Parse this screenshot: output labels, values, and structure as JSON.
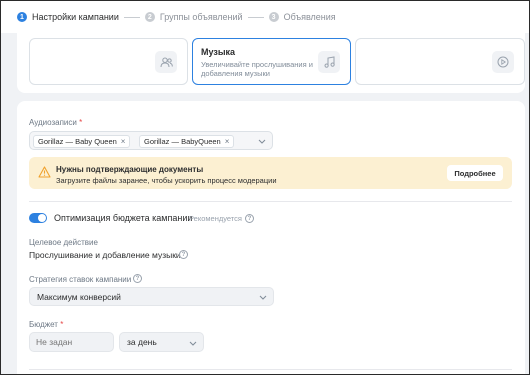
{
  "stepper": {
    "steps": [
      {
        "num": "1",
        "label": "Настройки кампании"
      },
      {
        "num": "2",
        "label": "Группы объявлений"
      },
      {
        "num": "3",
        "label": "Объявления"
      }
    ]
  },
  "objectives": {
    "cards": [
      {
        "title": "",
        "desc": "",
        "icon": "users-icon"
      },
      {
        "title": "Музыка",
        "desc": "Увеличивайте прослушивания и добавления музыки",
        "icon": "music-note-icon"
      },
      {
        "title": "",
        "desc": "",
        "icon": "play-circle-icon"
      }
    ]
  },
  "audio": {
    "label": "Аудиозаписи",
    "required_mark": "*",
    "chips": [
      "Gorillaz — Baby Queen",
      "Gorillaz — BabyQueen"
    ],
    "remove_glyph": "×"
  },
  "warning": {
    "title": "Нужны подтверждающие документы",
    "text": "Загрузите файлы заранее, чтобы ускорить процесс модерации",
    "button": "Подробнее",
    "icon": "warning-icon"
  },
  "budget_optimization": {
    "label": "Оптимизация бюджета кампании",
    "recommended": "Рекомендуется",
    "enabled": true
  },
  "target_action": {
    "label": "Целевое действие",
    "value": "Прослушивание и добавление музыки"
  },
  "bid_strategy": {
    "label": "Стратегия ставок кампании",
    "value": "Максимум конверсий"
  },
  "budget": {
    "label": "Бюджет",
    "required_mark": "*",
    "placeholder": "Не задан",
    "period": "за день"
  },
  "help_glyph": "?",
  "colors": {
    "accent": "#2d81e0",
    "warning_bg": "#fcf0d2",
    "warning_icon": "#f0a12c",
    "required": "#e64646"
  }
}
